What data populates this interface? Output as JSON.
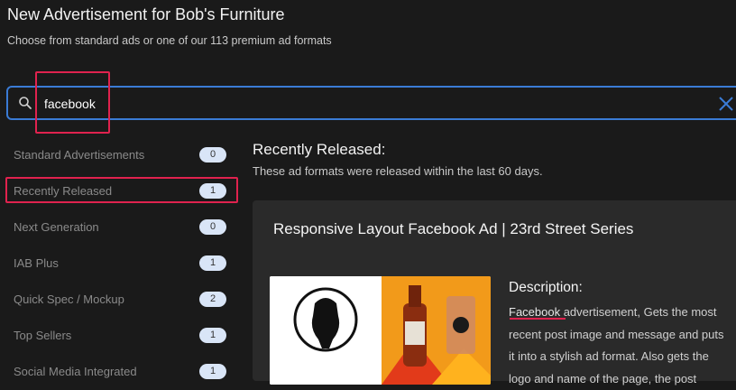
{
  "header": {
    "title": "New Advertisement for Bob's Furniture",
    "subtitle": "Choose from standard ads or one of our 113 premium ad formats"
  },
  "search": {
    "value": "facebook",
    "icon": "search-icon",
    "clear_icon": "close-icon"
  },
  "sidebar": {
    "items": [
      {
        "label": "Standard Advertisements",
        "count": "0"
      },
      {
        "label": "Recently Released",
        "count": "1"
      },
      {
        "label": "Next Generation",
        "count": "0"
      },
      {
        "label": "IAB Plus",
        "count": "1"
      },
      {
        "label": "Quick Spec / Mockup",
        "count": "2"
      },
      {
        "label": "Top Sellers",
        "count": "1"
      },
      {
        "label": "Social Media Integrated",
        "count": "1"
      }
    ]
  },
  "main": {
    "section_title": "Recently Released:",
    "section_desc": "These ad formats were released within the last 60 days.",
    "card": {
      "title": "Responsive Layout Facebook Ad | 23rd Street Series",
      "description_heading": "Description:",
      "description_keyword": "Facebook",
      "description_text": " advertisement, Gets the most recent post image and message and puts it into a stylish ad format. Also gets the logo and name of the page, the post"
    }
  },
  "colors": {
    "background": "#1a1a1a",
    "accent": "#3a7bd5",
    "highlight": "#e0224e",
    "card": "#2a2a2a",
    "badge": "#d9e5f7"
  }
}
